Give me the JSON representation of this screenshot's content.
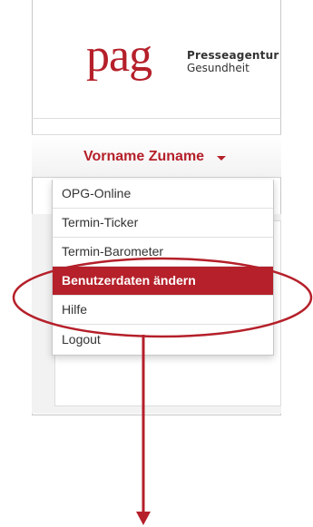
{
  "brand": {
    "logo_word": "pag",
    "logo_line1": "Presseagentur",
    "logo_line2": "Gesundheit",
    "color": "#b5202a"
  },
  "user_menu": {
    "user_name": "Vorname Zuname",
    "toggle_icon": "caret-down-icon",
    "items": [
      {
        "label": "OPG-Online",
        "active": false
      },
      {
        "label": "Termin-Ticker",
        "active": false
      },
      {
        "label": "Termin-Barometer",
        "active": false
      },
      {
        "label": "Benutzerdaten ändern",
        "active": true
      },
      {
        "label": "Hilfe",
        "active": false
      },
      {
        "label": "Logout",
        "active": false
      }
    ]
  },
  "annotation": {
    "color": "#b5202a",
    "highlighted_item": "Benutzerdaten ändern",
    "icons": [
      "highlight-ellipse",
      "arrow-down-icon"
    ]
  }
}
